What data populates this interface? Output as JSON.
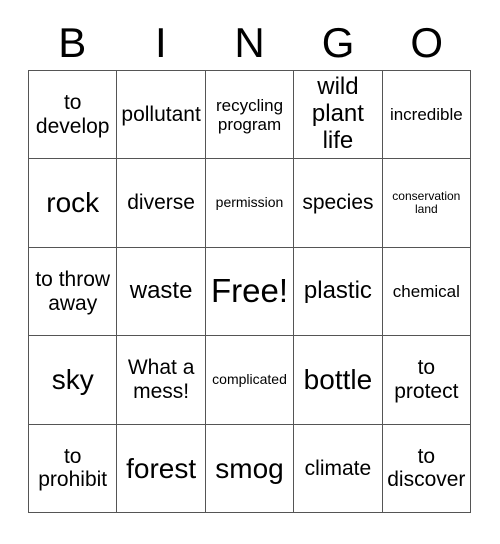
{
  "card": {
    "title": "BINGO",
    "headers": [
      "B",
      "I",
      "N",
      "G",
      "O"
    ],
    "free_space_label": "Free!",
    "border_color": "#555555",
    "text_color": "#000000",
    "background_color": "#ffffff",
    "rows": [
      [
        {
          "text": "to develop",
          "size": "md"
        },
        {
          "text": "pollutant",
          "size": "md"
        },
        {
          "text": "recycling program",
          "size": "sm"
        },
        {
          "text": "wild plant life",
          "size": "lg"
        },
        {
          "text": "incredible",
          "size": "sm"
        }
      ],
      [
        {
          "text": "rock",
          "size": "xl"
        },
        {
          "text": "diverse",
          "size": "md"
        },
        {
          "text": "permission",
          "size": "xs"
        },
        {
          "text": "species",
          "size": "md"
        },
        {
          "text": "conservation land",
          "size": "xxs"
        }
      ],
      [
        {
          "text": "to throw away",
          "size": "md"
        },
        {
          "text": "waste",
          "size": "lg"
        },
        {
          "text": "Free!",
          "size": "xxl"
        },
        {
          "text": "plastic",
          "size": "lg"
        },
        {
          "text": "chemical",
          "size": "sm"
        }
      ],
      [
        {
          "text": "sky",
          "size": "xl"
        },
        {
          "text": "What a mess!",
          "size": "md"
        },
        {
          "text": "complicated",
          "size": "xs"
        },
        {
          "text": "bottle",
          "size": "xl"
        },
        {
          "text": "to protect",
          "size": "md"
        }
      ],
      [
        {
          "text": "to prohibit",
          "size": "md"
        },
        {
          "text": "forest",
          "size": "xl"
        },
        {
          "text": "smog",
          "size": "xl"
        },
        {
          "text": "climate",
          "size": "md"
        },
        {
          "text": "to discover",
          "size": "md"
        }
      ]
    ]
  }
}
